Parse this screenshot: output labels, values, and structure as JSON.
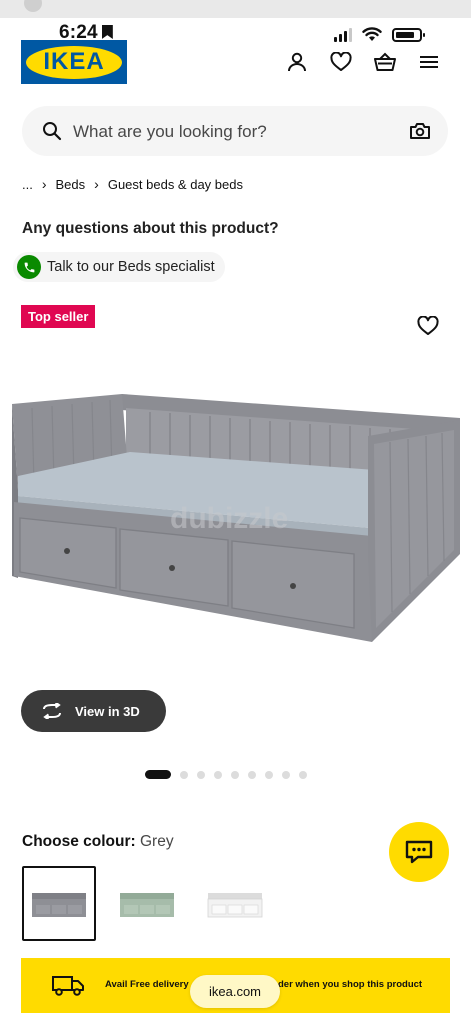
{
  "status_bar": {
    "time": "6:24"
  },
  "header": {
    "logo_text": "IKEA"
  },
  "search": {
    "placeholder": "What are you looking for?"
  },
  "breadcrumb": {
    "items": [
      "...",
      "Beds",
      "Guest beds & day beds"
    ]
  },
  "help": {
    "title": "Any questions about this product?",
    "specialist_label": "Talk to our Beds specialist"
  },
  "product": {
    "badge": "Top seller",
    "view_3d_label": "View in 3D",
    "gallery": {
      "total_images": 9,
      "active_index": 1
    },
    "watermark": "dubizzle"
  },
  "colour": {
    "label": "Choose colour:",
    "value": "Grey",
    "options": [
      {
        "name": "Grey",
        "color": "#8e8f95"
      },
      {
        "name": "Grey-green",
        "color": "#a6bcaa"
      },
      {
        "name": "White",
        "color": "#f2f2f2"
      }
    ]
  },
  "promo": {
    "text_left": "Avail Free delivery",
    "text_right": "der when you shop this product"
  },
  "browser": {
    "url": "ikea.com"
  },
  "colors": {
    "ikea_blue": "#0058a3",
    "ikea_yellow": "#ffdb00",
    "badge_red": "#e00751",
    "specialist_green": "#0a8a00"
  }
}
